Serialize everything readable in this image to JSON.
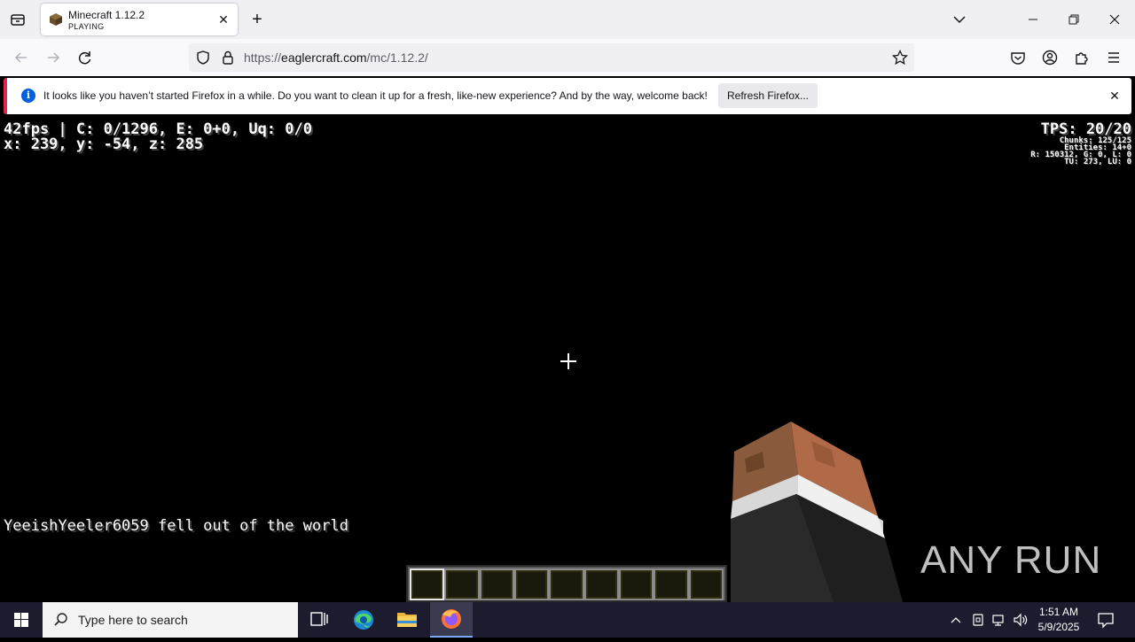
{
  "browser": {
    "tab": {
      "title": "Minecraft 1.12.2",
      "subtitle": "PLAYING",
      "close_glyph": "✕"
    },
    "new_tab_glyph": "+",
    "url": {
      "scheme": "https://",
      "host": "eaglercraft.com",
      "path": "/mc/1.12.2/"
    },
    "notification": {
      "message": "It looks like you haven’t started Firefox in a while. Do you want to clean it up for a fresh, like-new experience? And by the way, welcome back!",
      "button": "Refresh Firefox...",
      "icon_glyph": "i",
      "close_glyph": "✕"
    }
  },
  "game": {
    "debug_line1": "42fps | C: 0/1296, E: 0+0, Uq: 0/0",
    "debug_line2": "x: 239, y: -54, z: 285",
    "tps": "TPS: 20/20",
    "small_debug": [
      "Chunks: 125/125",
      "Entities: 14+0",
      "R: 150312, G: 0, L: 0",
      "TU: 273, LU: 0"
    ],
    "chat_message": "YeeishYeeler6059 fell out of the world",
    "hotbar_slots": 9,
    "selected_slot": 1
  },
  "watermark": "ANY RUN",
  "taskbar": {
    "search_placeholder": "Type here to search",
    "time": "1:51 AM",
    "date": "5/9/2025"
  },
  "colors": {
    "notification_accent": "#e22850",
    "info_blue": "#0060df",
    "taskbar": "#1c1c2e"
  }
}
